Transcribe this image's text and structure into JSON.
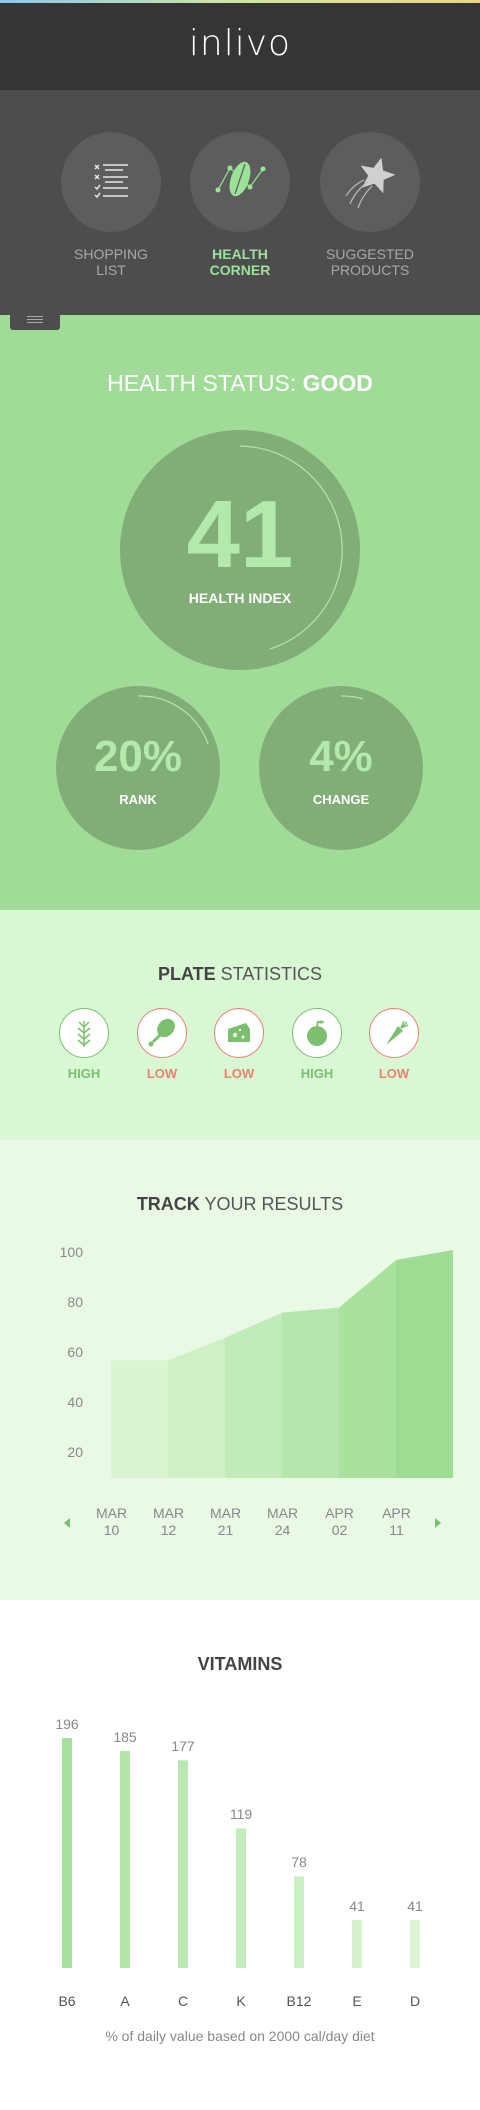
{
  "header": {
    "logo": "inlivo"
  },
  "nav": {
    "items": [
      {
        "label": "SHOPPING\nLIST",
        "icon": "checklist-icon",
        "active": false
      },
      {
        "label": "HEALTH\nCORNER",
        "icon": "leaf-icon",
        "active": true
      },
      {
        "label": "SUGGESTED\nPRODUCTS",
        "icon": "shooting-star-icon",
        "active": false
      }
    ]
  },
  "health": {
    "title_prefix": "HEALTH STATUS: ",
    "title_value": "GOOD",
    "index_value": "41",
    "index_label": "HEALTH INDEX",
    "rank_value": "20%",
    "rank_label": "RANK",
    "change_value": "4%",
    "change_label": "CHANGE"
  },
  "plate": {
    "title_bold": "PLATE",
    "title_rest": " STATISTICS",
    "items": [
      {
        "icon": "wheat-icon",
        "level": "HIGH"
      },
      {
        "icon": "drumstick-icon",
        "level": "LOW"
      },
      {
        "icon": "cheese-icon",
        "level": "LOW"
      },
      {
        "icon": "apple-icon",
        "level": "HIGH"
      },
      {
        "icon": "carrot-icon",
        "level": "LOW"
      }
    ]
  },
  "track": {
    "title_bold": "TRACK",
    "title_rest": " YOUR RESULTS"
  },
  "vitamins": {
    "title": "VITAMINS",
    "footnote": "% of daily value based on 2000 cal/day diet"
  },
  "colors": {
    "high": "#7bbf6f",
    "low": "#ee8070",
    "accent": "#9be39a"
  },
  "chart_data": [
    {
      "type": "area",
      "categories": [
        "MAR\n10",
        "MAR\n12",
        "MAR\n21",
        "MAR\n24",
        "APR\n02",
        "APR\n11"
      ],
      "values": [
        57,
        66,
        76,
        78,
        97,
        101
      ],
      "yticks": [
        20,
        40,
        60,
        80,
        100
      ],
      "ylim": [
        10,
        105
      ],
      "grid": false
    },
    {
      "type": "bar",
      "categories": [
        "B6",
        "A",
        "C",
        "K",
        "B12",
        "E",
        "D"
      ],
      "values": [
        196,
        185,
        177,
        119,
        78,
        41,
        41
      ],
      "value_labels": [
        "196",
        "185",
        "177",
        "119",
        "78",
        "41",
        "41"
      ],
      "grid": false
    }
  ]
}
